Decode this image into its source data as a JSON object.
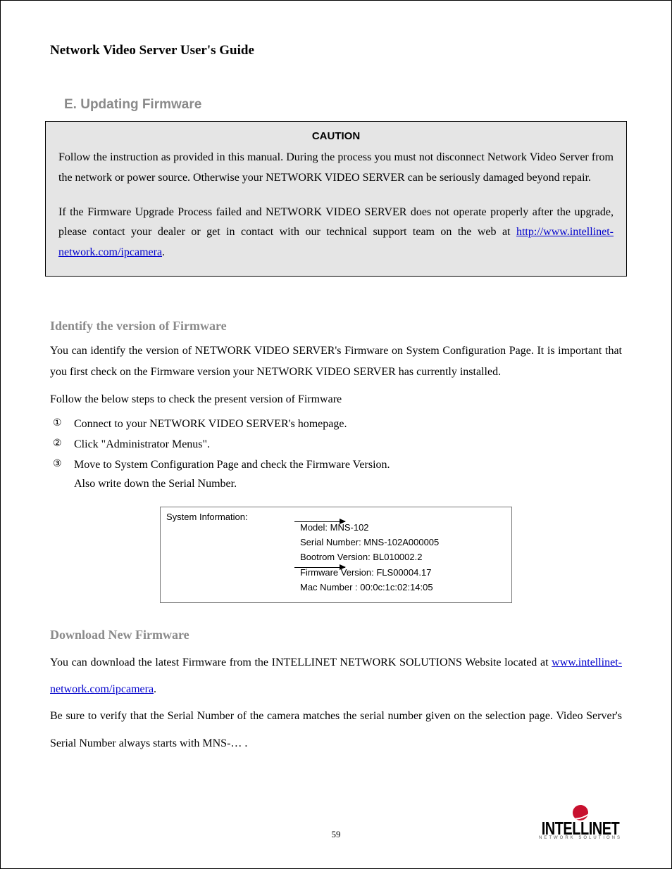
{
  "header": {
    "title": "Network Video Server User's Guide"
  },
  "section_e": {
    "heading": "E. Updating Firmware"
  },
  "caution": {
    "title": "CAUTION",
    "p1": "Follow the instruction as provided in this manual. During the process you must not disconnect Network Video Server from the network or power source. Otherwise your NETWORK VIDEO SERVER can be seriously damaged beyond repair.",
    "p2_a": "If the Firmware Upgrade Process failed and NETWORK VIDEO SERVER does not operate properly after the upgrade, please contact your dealer or get in contact with our technical support team on the web at ",
    "p2_link": "http://www.intellinet-network.com/ipcamera",
    "p2_b": "."
  },
  "identify": {
    "heading": "Identify the version of Firmware",
    "body": "You can identify the version of NETWORK VIDEO SERVER's Firmware on System Configuration Page. It is important that you first check on the Firmware version your NETWORK VIDEO SERVER has currently installed.",
    "lead": "Follow the below steps to check the present version of Firmware",
    "steps": [
      "Connect to your NETWORK VIDEO SERVER's homepage.",
      "Click \"Administrator Menus\".",
      "Move to System Configuration Page and check the Firmware Version."
    ],
    "step3_extra": "Also write down the Serial Number."
  },
  "sysinfo": {
    "label": "System Information:",
    "model": "Model: MNS-102",
    "serial": "Serial Number: MNS-102A000005",
    "bootrom": "Bootrom Version: BL010002.2",
    "firmware": "Firmware Version: FLS00004.17",
    "mac": "Mac Number : 00:0c:1c:02:14:05"
  },
  "download": {
    "heading": "Download New Firmware",
    "p1_a": "You can download the latest Firmware from the INTELLINET NETWORK SOLUTIONS Website located at ",
    "p1_link": "www.intellinet-network.com/ipcamera",
    "p1_b": ".",
    "p2": "Be sure to verify that the Serial Number of the camera matches the serial number given on the selection page. Video Server's Serial Number always starts with MNS-… ."
  },
  "footer": {
    "page_number": "59",
    "logo_word": "INTELLINET",
    "logo_tag": "NETWORK SOLUTIONS"
  },
  "markers": [
    "①",
    "②",
    "③"
  ]
}
